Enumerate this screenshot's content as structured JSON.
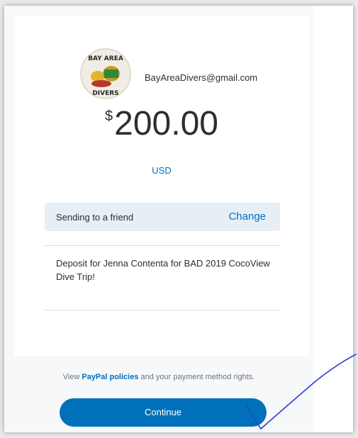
{
  "recipient": {
    "avatar_text_top": "BAY AREA",
    "avatar_text_bottom": "DIVERS",
    "email": "BayAreaDivers@gmail.com"
  },
  "amount": {
    "currency_symbol": "$",
    "value": "200.00",
    "currency_code": "USD"
  },
  "sending": {
    "label": "Sending to a friend",
    "change_label": "Change"
  },
  "note": "Deposit for Jenna Contenta for BAD 2019 CocoView Dive Trip!",
  "footer": {
    "policies_prefix": "View ",
    "policies_link": "PayPal policies",
    "policies_suffix": " and your payment method rights.",
    "continue_label": "Continue"
  },
  "colors": {
    "accent": "#0070ba",
    "sending_bg": "#e8eef6",
    "annotation_ink": "#2a3fd8"
  }
}
